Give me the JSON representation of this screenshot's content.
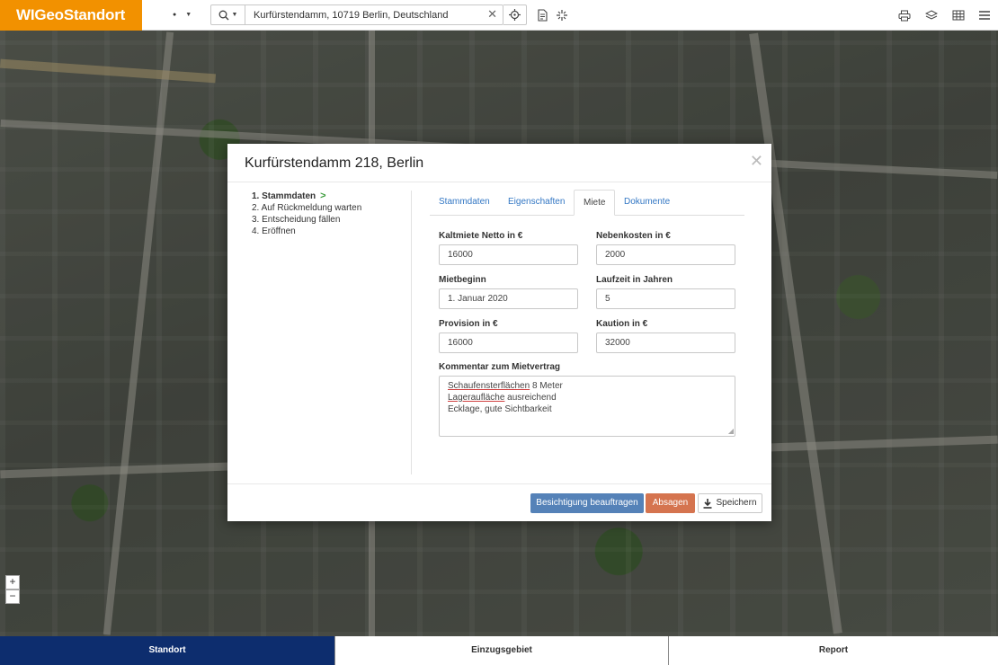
{
  "app": {
    "logo": "WIGeoStandort"
  },
  "search": {
    "value": "Kurfürstendamm, 10719 Berlin, Deutschland",
    "clear_glyph": "✕"
  },
  "toolbar": {
    "dot_menu": "●",
    "icons": [
      "search-icon",
      "locate-icon",
      "document-icon",
      "cursor-tool-icon",
      "print-icon",
      "layers-icon",
      "table-icon",
      "menu-icon"
    ]
  },
  "map": {
    "zoom_in": "+",
    "zoom_out": "−"
  },
  "dialog": {
    "title": "Kurfürstendamm 218, Berlin",
    "close_glyph": "✕",
    "steps": [
      {
        "number": "1.",
        "label": "Stammdaten",
        "active": true
      },
      {
        "number": "2.",
        "label": "Auf Rückmeldung warten"
      },
      {
        "number": "3.",
        "label": "Entscheidung fällen"
      },
      {
        "number": "4.",
        "label": "Eröffnen"
      }
    ],
    "tabs": [
      {
        "label": "Stammdaten"
      },
      {
        "label": "Eigenschaften"
      },
      {
        "label": "Miete",
        "active": true
      },
      {
        "label": "Dokumente"
      }
    ],
    "form": {
      "kaltmiete_label": "Kaltmiete Netto in €",
      "kaltmiete_value": "16000",
      "nebenkosten_label": "Nebenkosten in €",
      "nebenkosten_value": "2000",
      "mietbeginn_label": "Mietbeginn",
      "mietbeginn_value": "1. Januar 2020",
      "laufzeit_label": "Laufzeit in Jahren",
      "laufzeit_value": "5",
      "provision_label": "Provision in €",
      "provision_value": "16000",
      "kaution_label": "Kaution in €",
      "kaution_value": "32000",
      "kommentar_label": "Kommentar zum Mietvertrag",
      "kommentar_lines": [
        {
          "underlined": "Schaufensterflächen",
          "rest": " 8 Meter"
        },
        {
          "underlined": "Lageraufläche",
          "rest": " ausreichend"
        },
        {
          "underlined": "",
          "rest": "Ecklage, gute Sichtbarkeit"
        }
      ]
    },
    "buttons": {
      "besichtigung": "Besichtigung beauftragen",
      "absagen": "Absagen",
      "speichern": "Speichern"
    }
  },
  "bottom_tabs": [
    {
      "label": "Standort",
      "active": true
    },
    {
      "label": "Einzugsgebiet"
    },
    {
      "label": "Report"
    }
  ],
  "colors": {
    "logo_bg": "#f29100",
    "primary_button": "#5582b8",
    "danger_button": "#d5744f",
    "active_bottom_tab": "#0d2d6e",
    "link": "#3377c4",
    "step_chevron": "#3a9b3a"
  }
}
